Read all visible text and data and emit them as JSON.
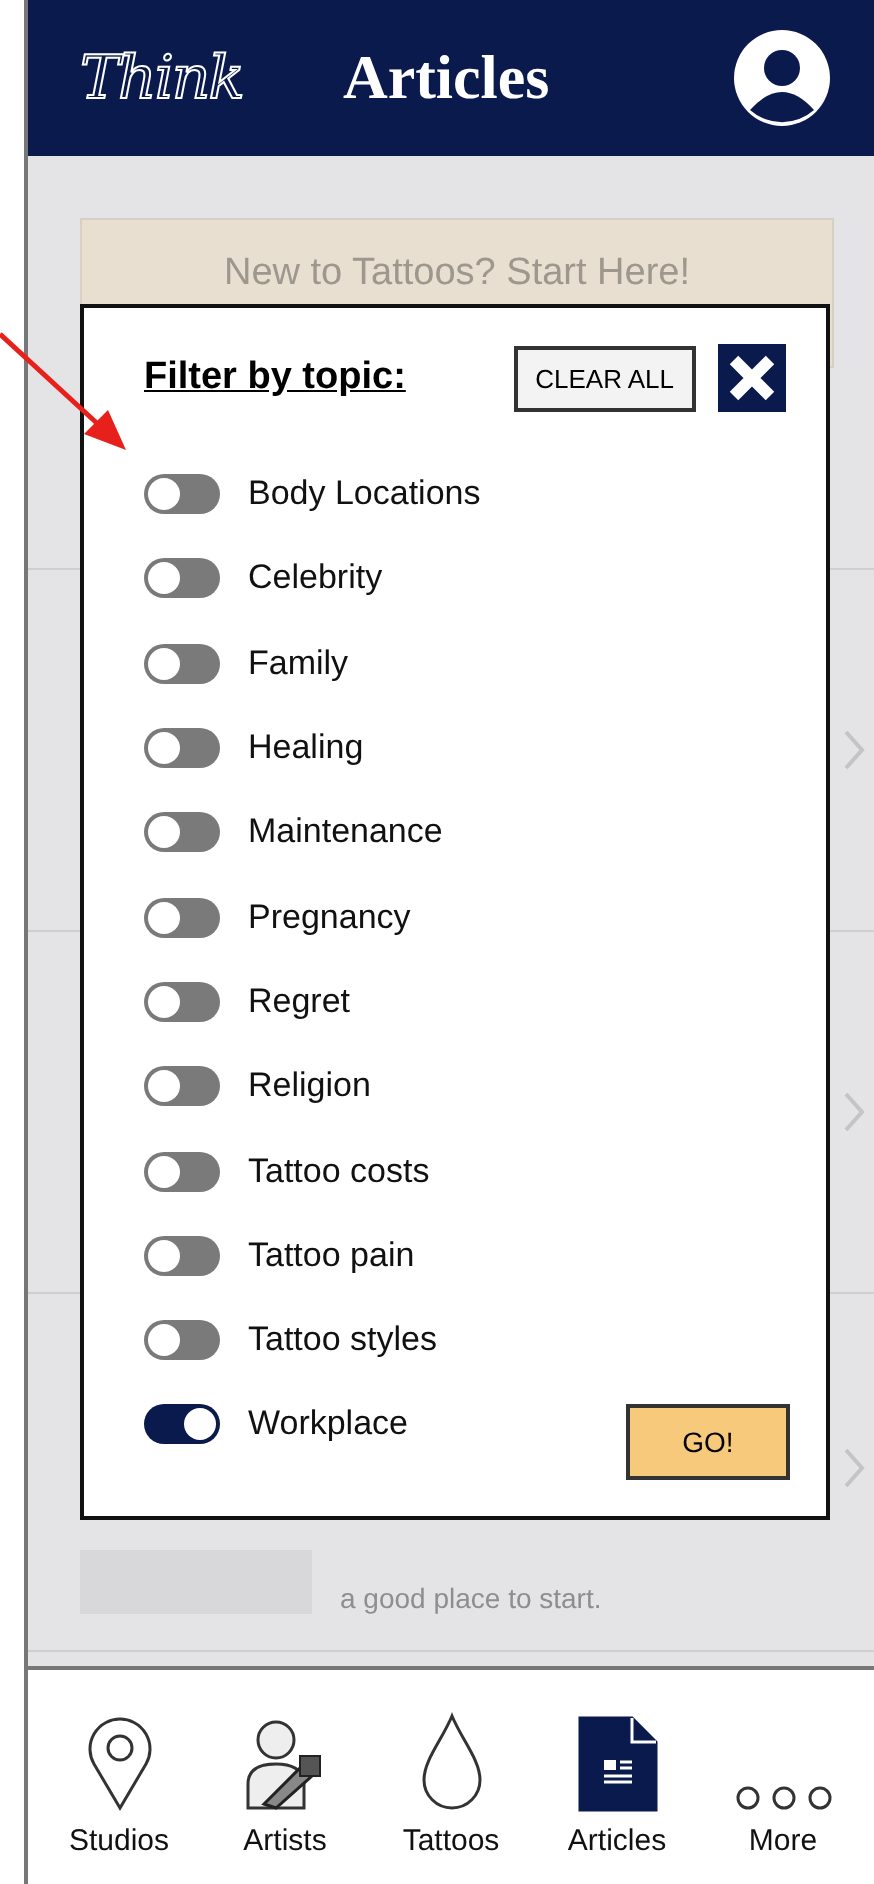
{
  "header": {
    "logo": "Think",
    "title": "Articles"
  },
  "background": {
    "banner": "New to Tattoos? Start Here!",
    "snippet": "a good place to start."
  },
  "filter": {
    "title": "Filter by topic:",
    "clear_button": "CLEAR ALL",
    "go_button": "GO!",
    "topics": [
      {
        "label": "Body Locations",
        "on": false
      },
      {
        "label": "Celebrity",
        "on": false
      },
      {
        "label": "Family",
        "on": false
      },
      {
        "label": "Healing",
        "on": false
      },
      {
        "label": "Maintenance",
        "on": false
      },
      {
        "label": "Pregnancy",
        "on": false
      },
      {
        "label": "Regret",
        "on": false
      },
      {
        "label": "Religion",
        "on": false
      },
      {
        "label": "Tattoo costs",
        "on": false
      },
      {
        "label": "Tattoo pain",
        "on": false
      },
      {
        "label": "Tattoo styles",
        "on": false
      },
      {
        "label": "Workplace",
        "on": true
      }
    ]
  },
  "nav": [
    {
      "label": "Studios",
      "kind": "pin",
      "selected": false
    },
    {
      "label": "Artists",
      "kind": "artist",
      "selected": false
    },
    {
      "label": "Tattoos",
      "kind": "drop",
      "selected": false
    },
    {
      "label": "Articles",
      "kind": "document",
      "selected": true
    },
    {
      "label": "More",
      "kind": "more",
      "selected": false
    }
  ]
}
